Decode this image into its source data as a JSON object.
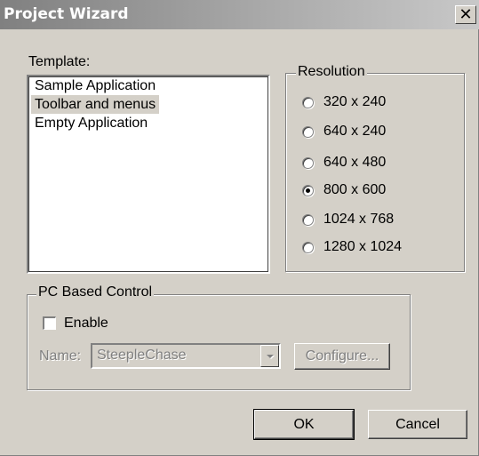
{
  "window": {
    "title": "Project Wizard",
    "close_glyph": "✕"
  },
  "template": {
    "label": "Template:",
    "items": [
      {
        "label": "Sample Application",
        "selected": false
      },
      {
        "label": "Toolbar and menus",
        "selected": true
      },
      {
        "label": "Empty Application",
        "selected": false
      }
    ]
  },
  "resolution": {
    "label": "Resolution",
    "options": [
      {
        "label": "320 x 240",
        "checked": false
      },
      {
        "label": "640 x 240",
        "checked": false
      },
      {
        "label": "640 x 480",
        "checked": false
      },
      {
        "label": "800 x 600",
        "checked": true
      },
      {
        "label": "1024 x 768",
        "checked": false
      },
      {
        "label": "1280 x 1024",
        "checked": false
      }
    ]
  },
  "pc_control": {
    "label": "PC Based Control",
    "enable_label": "Enable",
    "enable_checked": false,
    "name_label": "Name:",
    "name_value": "SteepleChase",
    "configure_label": "Configure..."
  },
  "buttons": {
    "ok": "OK",
    "cancel": "Cancel"
  },
  "colors": {
    "dialog_bg": "#d4d0c8",
    "title_start": "#808080",
    "title_end": "#c8c8c8",
    "disabled_text": "#808080"
  }
}
